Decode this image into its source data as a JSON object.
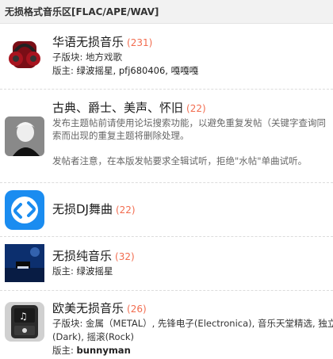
{
  "header": {
    "title": "无损格式音乐区[FLAC/APE/WAV]"
  },
  "forums": [
    {
      "name": "华语无损音乐",
      "count": "(231)",
      "sub_label": "子版块:",
      "sub_value": "地方戏歌",
      "mod_label": "版主:",
      "mods": "绿波摇星, pfj680406, 嘎嘎嘎"
    },
    {
      "name": "古典、爵士、美声、怀旧",
      "count": "(22)",
      "desc_line1": "发布主题帖前请使用论坛搜索功能，以避免重复发帖（关键字查询同",
      "desc_line2": "索而出现的重复主题将删除处理。",
      "desc_line3": "发帖者注意，在本版发帖要求全辑试听，拒绝\"水帖\"单曲试听。"
    },
    {
      "name": "无损DJ舞曲",
      "count": "(22)"
    },
    {
      "name": "无损纯音乐",
      "count": "(32)",
      "mod_label": "版主:",
      "mods": "绿波摇星"
    },
    {
      "name": "欧美无损音乐",
      "count": "(26)",
      "sub_label": "子版块:",
      "sub_value": "金属（METAL）, 先锋电子(Electronica), 音乐天堂精选, 独立",
      "sub_value2": "(Dark), 摇滚(Rock)",
      "mod_label": "版主:",
      "mods": "bunnyman"
    }
  ],
  "colors": {
    "count": "#f26c4f",
    "header_bg": "#f2f2f2"
  },
  "icons": [
    "headphones-icon",
    "portrait-icon",
    "shazam-icon",
    "piano-icon",
    "ipod-icon"
  ]
}
